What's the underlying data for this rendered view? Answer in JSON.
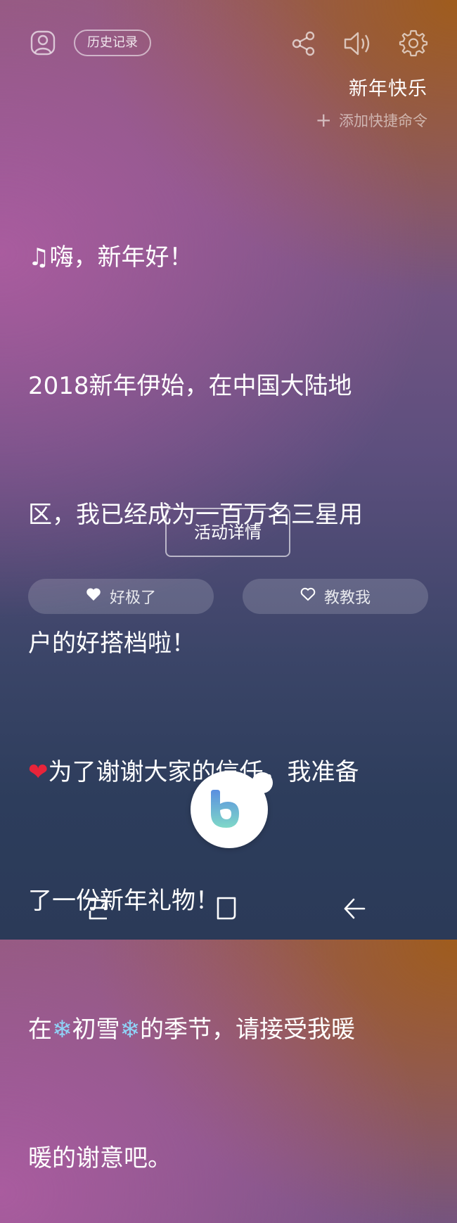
{
  "header": {
    "history_label": "历史记录",
    "title": "新年快乐",
    "add_shortcut_label": "添加快捷命令",
    "icons": [
      "profile-icon",
      "share-icon",
      "speaker-icon",
      "settings-icon"
    ]
  },
  "message": {
    "lines": [
      "嗨，新年好！",
      "2018新年伊始，在中国大陆地",
      "区，我已经成为一百万名三星用",
      "户的好搭档啦！",
      "为了谢谢大家的信任，我准备",
      "了一份新年礼物！",
      "在",
      "初雪",
      "的季节，请接受我暖",
      "暖的谢意吧。"
    ],
    "emoji_note": "♫",
    "emoji_heart": "❤",
    "emoji_snow": "❄"
  },
  "actions": {
    "detail_label": "活动详情",
    "like_label": "好极了",
    "teach_label": "教教我"
  },
  "colors": {
    "accent_top_right": "#a05c18",
    "accent_left": "#ac5ca0",
    "bottom": "#2b3a58",
    "bixby_blue": "#4a90d9"
  },
  "navbar": {
    "icons": [
      "recent-apps-icon",
      "home-icon",
      "back-icon"
    ]
  }
}
